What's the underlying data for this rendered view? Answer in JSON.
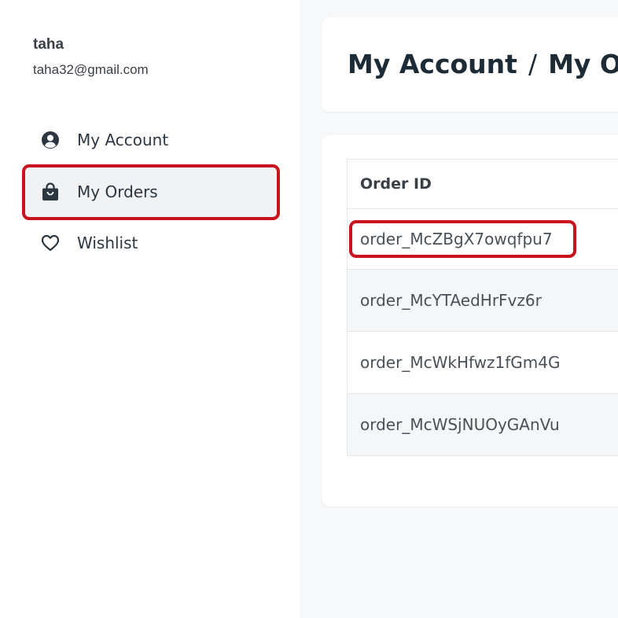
{
  "user": {
    "name": "taha",
    "email": "taha32@gmail.com"
  },
  "sidebar": {
    "items": [
      {
        "label": "My Account",
        "icon": "user-circle-icon",
        "active": false
      },
      {
        "label": "My Orders",
        "icon": "shopping-bag-icon",
        "active": true
      },
      {
        "label": "Wishlist",
        "icon": "heart-icon",
        "active": false
      }
    ]
  },
  "header": {
    "breadcrumb": [
      "My Account",
      "My Orders"
    ],
    "separator": "/"
  },
  "orders": {
    "columns": [
      "Order ID"
    ],
    "rows": [
      "order_McZBgX7owqfpu7",
      "order_McYTAedHrFvz6r",
      "order_McWkHfwz1fGm4G",
      "order_McWSjNUOyGAnVu"
    ]
  },
  "colors": {
    "highlight": "#c8141e",
    "active_bg": "#f0f2f4",
    "page_bg": "#f7f8fa"
  }
}
